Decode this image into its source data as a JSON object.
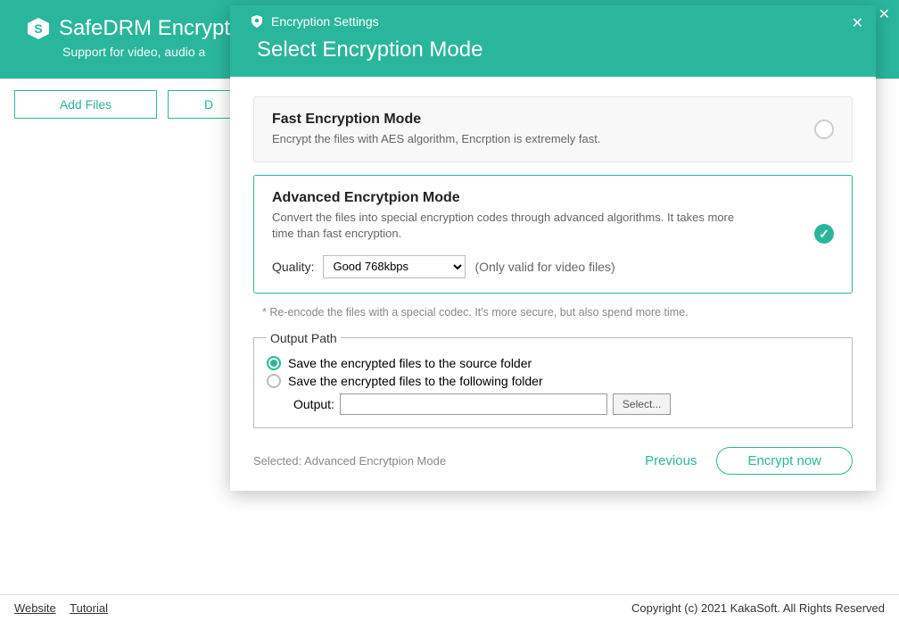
{
  "main": {
    "title": "SafeDRM Encryptio",
    "subtitle": "Support for video, audio a",
    "toolbar": {
      "add_files": "Add Files",
      "second_btn": "D"
    }
  },
  "statusbar": {
    "website": "Website",
    "tutorial": "Tutorial",
    "copyright": "Copyright (c) 2021 KakaSoft. All Rights Reserved"
  },
  "modal": {
    "header_small": "Encryption Settings",
    "title": "Select Encryption Mode",
    "fast": {
      "title": "Fast Encryption Mode",
      "desc": "Encrypt the files with AES algorithm, Encrption is extremely fast."
    },
    "advanced": {
      "title": "Advanced Encrytpion Mode",
      "desc": "Convert the files into special encryption codes through advanced algorithms. It takes more time than fast encryption.",
      "quality_label": "Quality:",
      "quality_value": "Good 768kbps",
      "quality_note": "(Only valid for video files)"
    },
    "hint": "* Re-encode the files with a special codec. It's more secure, but also spend more time.",
    "output": {
      "legend": "Output Path",
      "opt_source": "Save the encrypted files to the source folder",
      "opt_custom": "Save the encrypted files to the following folder",
      "output_label": "Output:",
      "output_value": "",
      "select_btn": "Select..."
    },
    "footer": {
      "selected": "Selected: Advanced Encrytpion Mode",
      "previous": "Previous",
      "encrypt": "Encrypt now"
    }
  }
}
